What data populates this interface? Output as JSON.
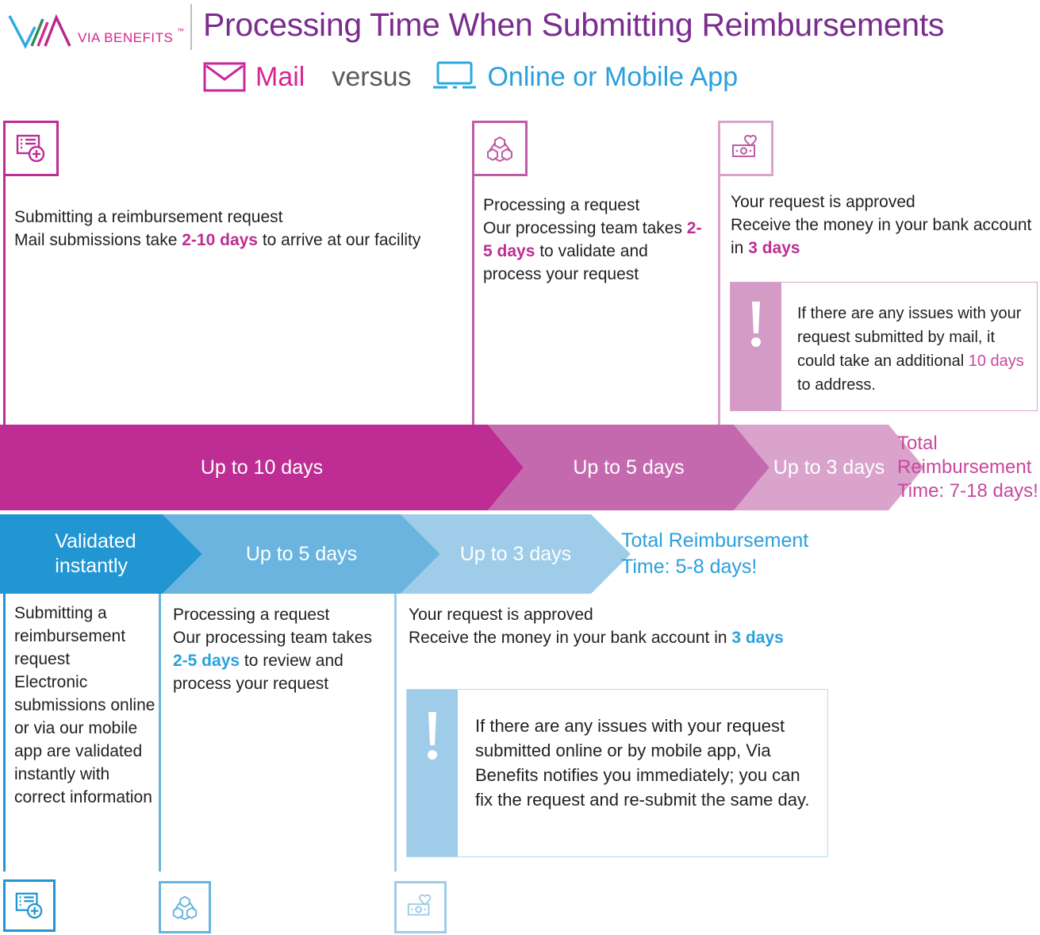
{
  "header": {
    "logo_text": "VIA BENEFITS",
    "logo_tm": "™",
    "title": "Processing Time When Submitting Reimbursements",
    "mail_label": "Mail",
    "versus_label": "versus",
    "online_label": "Online or Mobile App",
    "mail_icon": "envelope-icon",
    "laptop_icon": "laptop-icon"
  },
  "colors": {
    "brand_magenta": "#BD2D93",
    "magenta_mid": "#C569AE",
    "magenta_light": "#D9A3CC",
    "magenta_text": "#C9479F",
    "title_purple": "#7B2C8F",
    "blue": "#2196D3",
    "blue_mid": "#6AB4DF",
    "blue_light": "#9ECCE9",
    "blue_text": "#2BA0DC",
    "body_text": "#231F20",
    "versus_gray": "#5A5A5A"
  },
  "mail_track": {
    "steps": [
      {
        "icon": "form-add-icon",
        "heading": "Submitting a reimbursement request",
        "body_before": "Mail submissions take ",
        "highlight": "2-10 days",
        "body_after": " to arrive at our facility"
      },
      {
        "icon": "process-nodes-icon",
        "heading": "Processing a request",
        "body_before": "Our processing team takes ",
        "highlight": "2-5 days",
        "body_after": " to validate and process your request"
      },
      {
        "icon": "money-heart-icon",
        "heading": "Your request is approved",
        "body_before": "Receive the money in your bank account in ",
        "highlight": "3 days",
        "body_after": ""
      }
    ],
    "callout": {
      "icon": "exclamation-icon",
      "text_before": "If there are any issues with your request submitted by mail, it could take an additional ",
      "highlight": "10 days",
      "text_after": " to address."
    },
    "chevrons": [
      "Up to 10 days",
      "Up to 5 days",
      "Up to 3 days"
    ],
    "total_line1": "Total",
    "total_line2": "Reimbursement",
    "total_line3": "Time: 7-18 days!"
  },
  "online_track": {
    "chevrons": [
      "Validated\ninstantly",
      "Up to 5 days",
      "Up to 3 days"
    ],
    "chevron1_line1": "Validated",
    "chevron1_line2": "instantly",
    "total_line1": "Total Reimbursement",
    "total_line2": "Time: 5-8 days!",
    "steps": [
      {
        "icon": "form-add-icon",
        "heading": "Submitting a reimbursement request",
        "body_before": "Electronic submissions online or via our mobile app are validated instantly with correct information",
        "highlight": "",
        "body_after": ""
      },
      {
        "icon": "process-nodes-icon",
        "heading": "Processing a request",
        "body_before": "Our processing team takes ",
        "highlight": "2-5 days",
        "body_after": " to review and process your request"
      },
      {
        "icon": "money-heart-icon",
        "heading": "Your request is approved",
        "body_before": "Receive the money in your bank account in ",
        "highlight": "3 days",
        "body_after": ""
      }
    ],
    "callout": {
      "icon": "exclamation-icon",
      "text": "If there are any issues with your request submitted online or by mobile app, Via Benefits notifies you immediately; you can fix the request and re-submit the same day."
    }
  }
}
